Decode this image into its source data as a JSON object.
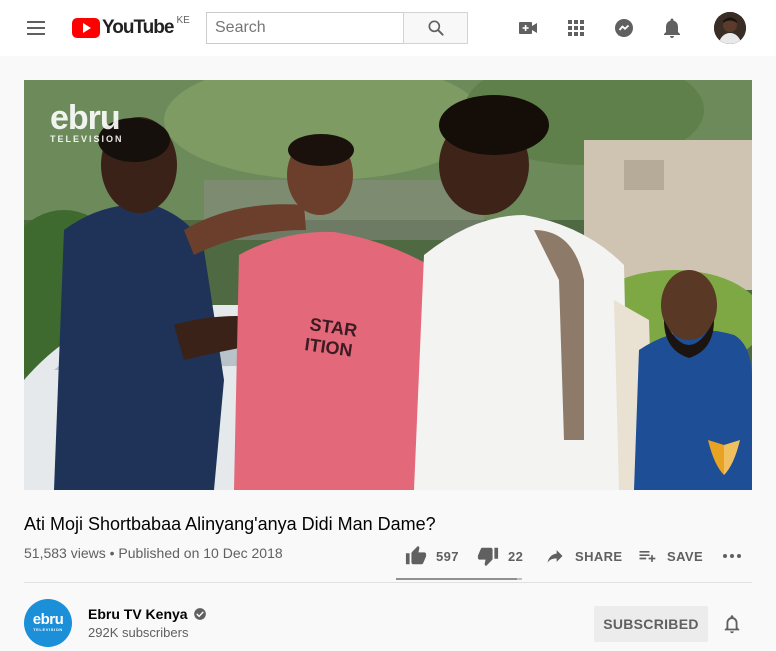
{
  "header": {
    "logo_text": "YouTube",
    "country_code": "KE",
    "search_placeholder": "Search",
    "icons": [
      "menu-icon",
      "search-icon",
      "video-camera-icon",
      "apps-icon",
      "messages-icon",
      "bell-icon"
    ]
  },
  "player": {
    "watermark_top": "ebru",
    "watermark_bottom": "TELEVISION"
  },
  "video": {
    "title": "Ati Moji Shortbabaa Alinyang'anya Didi Man Dame?",
    "views": "51,583 views",
    "separator": "•",
    "published": "Published on 10 Dec 2018",
    "likes": "597",
    "dislikes": "22",
    "like_ratio": 0.964,
    "share_label": "SHARE",
    "save_label": "SAVE"
  },
  "channel": {
    "avatar_top": "ebru",
    "avatar_bottom": "TELEVISION",
    "name": "Ebru TV Kenya",
    "subscribers": "292K subscribers",
    "subscribe_label": "SUBSCRIBED"
  },
  "colors": {
    "brand_red": "#ff0000",
    "icon_gray": "#606060",
    "channel_blue": "#1b8fd8",
    "background": "#f9f9f9"
  }
}
